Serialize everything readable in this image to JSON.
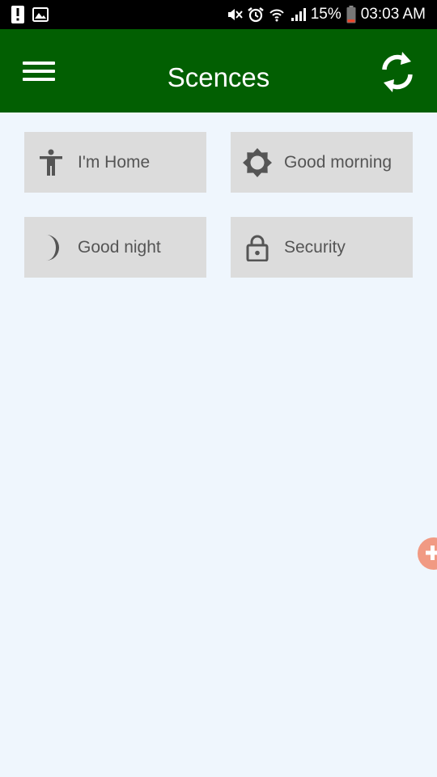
{
  "status_bar": {
    "battery": "15%",
    "time": "03:03 AM",
    "left_icons": [
      "alert-icon",
      "image-icon"
    ],
    "right_icons": [
      "mute-vibrate-icon",
      "alarm-icon",
      "wifi-icon",
      "signal-icon",
      "battery-icon"
    ]
  },
  "app_bar": {
    "title": "Scences",
    "background_color": "#025f02",
    "menu_icon": "hamburger-menu-icon",
    "action_icon": "refresh-icon"
  },
  "scenes": [
    {
      "label": "I'm Home",
      "icon": "person-icon"
    },
    {
      "label": "Good morning",
      "icon": "sun-icon"
    },
    {
      "label": "Good night",
      "icon": "moon-icon"
    },
    {
      "label": "Security",
      "icon": "lock-icon"
    }
  ],
  "floating_button": {
    "icon": "plus-icon",
    "color": "#f19a83"
  },
  "colors": {
    "background": "#eff6fd",
    "tile": "#dcdcdc",
    "tile_text": "#555555"
  }
}
